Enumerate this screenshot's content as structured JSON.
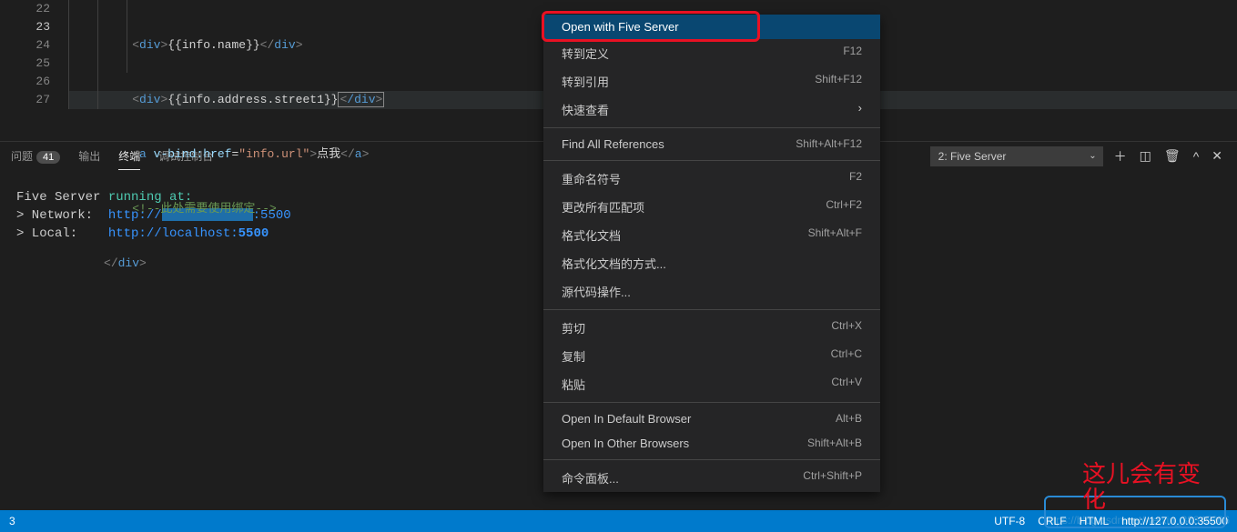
{
  "editor": {
    "lines": [
      22,
      23,
      24,
      25,
      26,
      27
    ],
    "activeLine": 23,
    "code": {
      "l22": {
        "indent": "         ",
        "open": "<",
        "tag": "div",
        "gt": ">",
        "text": "{{info.name}}",
        "closeA": "</",
        "closeB": ">"
      },
      "l23": {
        "indent": "         ",
        "open": "<",
        "tag": "div",
        "gt": ">",
        "text": "{{info.address.street1}}",
        "cursorOpen": "<",
        "cursorText": "/div",
        "cursorClose": ">"
      },
      "l24": {
        "indent": "         ",
        "open": "<",
        "tag": "a",
        "sp": " ",
        "attr": "v-bind:href",
        "eq": "=",
        "val": "\"info.url\"",
        "gt": ">",
        "text": "点我",
        "closeA": "</",
        "closeB": ">"
      },
      "l25": {
        "indent": "         ",
        "comment": "<!--此处需要使用绑定-->"
      },
      "l26": {
        "indent": "     ",
        "closeA": "</",
        "tag": "div",
        "closeB": ">"
      }
    }
  },
  "panel": {
    "tabs": {
      "problems": "问题",
      "output": "输出",
      "terminal": "终端",
      "debug": "调试控制台"
    },
    "problemsCount": "41",
    "select": "2: Five Server"
  },
  "terminal": {
    "fiveServer": "Five Server",
    "runningAt": "running at:",
    "networkLabel": "> Network:",
    "networkPrefix": "http://",
    "networkPort": ":5500",
    "localLabel": "> Local:",
    "localUrlA": "http://localhost:",
    "localUrlB": "5500"
  },
  "menu": {
    "groups": [
      [
        {
          "label": "Open with Five Server",
          "shortcut": "",
          "selected": true
        },
        {
          "label": "转到定义",
          "shortcut": "F12"
        },
        {
          "label": "转到引用",
          "shortcut": "Shift+F12"
        },
        {
          "label": "快速查看",
          "shortcut": "",
          "submenu": true
        }
      ],
      [
        {
          "label": "Find All References",
          "shortcut": "Shift+Alt+F12"
        }
      ],
      [
        {
          "label": "重命名符号",
          "shortcut": "F2"
        },
        {
          "label": "更改所有匹配项",
          "shortcut": "Ctrl+F2"
        },
        {
          "label": "格式化文档",
          "shortcut": "Shift+Alt+F"
        },
        {
          "label": "格式化文档的方式...",
          "shortcut": ""
        },
        {
          "label": "源代码操作...",
          "shortcut": ""
        }
      ],
      [
        {
          "label": "剪切",
          "shortcut": "Ctrl+X"
        },
        {
          "label": "复制",
          "shortcut": "Ctrl+C"
        },
        {
          "label": "粘贴",
          "shortcut": "Ctrl+V"
        }
      ],
      [
        {
          "label": "Open In Default Browser",
          "shortcut": "Alt+B"
        },
        {
          "label": "Open In Other Browsers",
          "shortcut": "Shift+Alt+B"
        }
      ],
      [
        {
          "label": "命令面板...",
          "shortcut": "Ctrl+Shift+P"
        }
      ]
    ]
  },
  "statusbar": {
    "pos": "3",
    "utf8": "UTF-8",
    "crlf": "CRLF",
    "lang": "HTML",
    "url": "http://127.0.0.0:35500"
  },
  "annotation": {
    "line1": "这儿会有变",
    "line2": "化"
  },
  "watermark": "https://blog.csdn.net/weixin_38345306"
}
